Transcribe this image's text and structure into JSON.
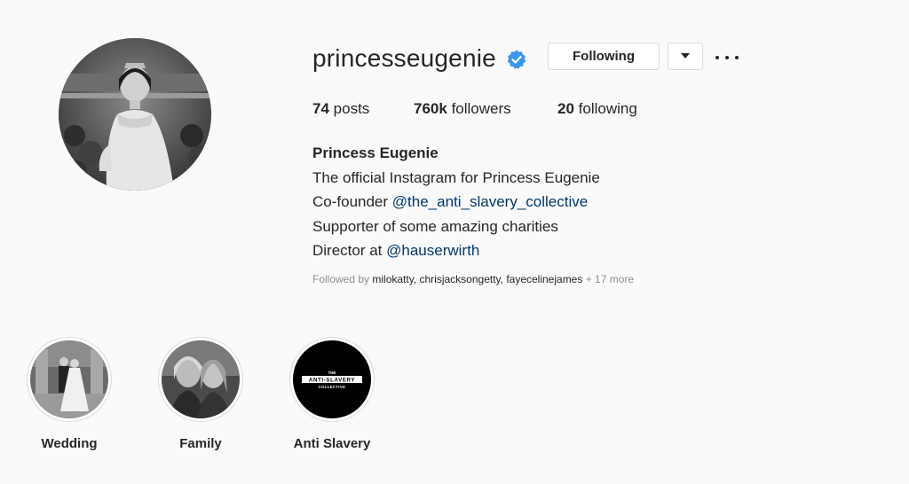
{
  "profile": {
    "username": "princesseugenie",
    "verified": true,
    "following_button": "Following",
    "stats": {
      "posts_count": "74",
      "posts_label": "posts",
      "followers_count": "760k",
      "followers_label": "followers",
      "following_count": "20",
      "following_label": "following"
    },
    "bio": {
      "name": "Princess Eugenie",
      "line1": "The official Instagram for Princess Eugenie",
      "line2_prefix": "Co-founder ",
      "line2_link": "@the_anti_slavery_collective",
      "line3": "Supporter of some amazing charities",
      "line4_prefix": "Director at ",
      "line4_link": "@hauserwirth"
    },
    "followed_by": {
      "prefix": "Followed by ",
      "users": "milokatty, chrisjacksongetty, fayecelinejames",
      "suffix": " + 17 more"
    }
  },
  "highlights": [
    {
      "label": "Wedding"
    },
    {
      "label": "Family"
    },
    {
      "label": "Anti Slavery",
      "cover_text": [
        "THE",
        "ANTI-SLAVERY",
        "COLLECTIVE"
      ]
    }
  ],
  "colors": {
    "background": "#fafafa",
    "text": "#262626",
    "link": "#00376b",
    "muted": "#8e8e8e",
    "verified_badge": "#3897f0",
    "border": "#dbdbdb"
  },
  "icons": [
    "verified-badge-icon",
    "chevron-down-icon",
    "more-options-icon"
  ]
}
